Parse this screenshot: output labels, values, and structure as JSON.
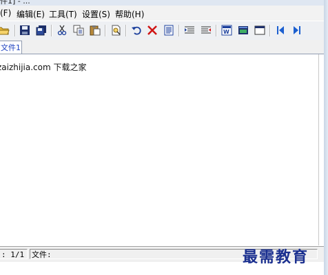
{
  "window": {
    "title_fragment": "件1] - ..."
  },
  "menu": [
    {
      "label": "(F)"
    },
    {
      "label": "编辑(E)"
    },
    {
      "label": "工具(T)"
    },
    {
      "label": "设置(S)"
    },
    {
      "label": "帮助(H)"
    }
  ],
  "toolbar": {
    "icons": [
      "open-folder-icon",
      "save-icon",
      "save-all-icon",
      "cut-icon",
      "copy-icon",
      "paste-icon",
      "find-icon",
      "undo-icon",
      "delete-icon",
      "document-icon",
      "indent-icon",
      "outdent-icon",
      "word-icon",
      "terminal-icon",
      "window-icon",
      "first-page-icon",
      "last-page-icon"
    ]
  },
  "tabs": [
    {
      "label": "文件1",
      "active": true
    }
  ],
  "editor": {
    "content": "zaizhijia.com  下载之家"
  },
  "status": {
    "page": ": 1/1",
    "file_label": "文件:"
  },
  "watermark": {
    "text": "最需教育"
  },
  "colors": {
    "menu_bg": "#f2f2f2",
    "toolbar_bg": "#eef0f3",
    "tab_text": "#1a3fbf",
    "watermark": "#1a2f8f"
  }
}
